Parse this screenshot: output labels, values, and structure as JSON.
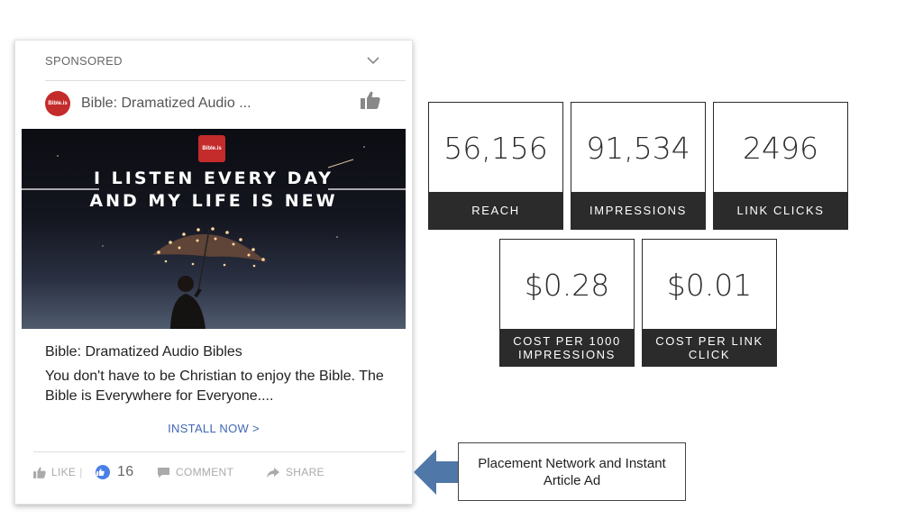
{
  "ad": {
    "sponsored_label": "SPONSORED",
    "page_name": "Bible: Dramatized Audio ...",
    "avatar_text": "Bible.is",
    "image": {
      "logo_text": "Bible.is",
      "headline_line1": "I LISTEN EVERY DAY",
      "headline_line2": "AND MY LIFE IS NEW"
    },
    "title": "Bible: Dramatized Audio Bibles",
    "description": "You don't have to be Christian to enjoy the Bible. The Bible is Everywhere for Everyone....",
    "cta": "INSTALL NOW >",
    "actions": {
      "like": "LIKE",
      "separator": "|",
      "reaction_count": "16",
      "comment": "COMMENT",
      "share": "SHARE"
    }
  },
  "metrics": [
    {
      "value": "56,156",
      "label": "REACH"
    },
    {
      "value": "91,534",
      "label": "IMPRESSIONS"
    },
    {
      "value": "2496",
      "label": "LINK CLICKS"
    },
    {
      "value": "$0.28",
      "label": "COST PER 1000\nIMPRESSIONS"
    },
    {
      "value": "$0.01",
      "label": "COST PER LINK\nCLICK"
    }
  ],
  "callout": {
    "text": "Placement Network and Instant Article Ad"
  },
  "colors": {
    "brand_red": "#c42b2b",
    "link_blue": "#4267b2",
    "tile_dark": "#2b2b2b",
    "arrow_blue": "#4f77a8"
  }
}
